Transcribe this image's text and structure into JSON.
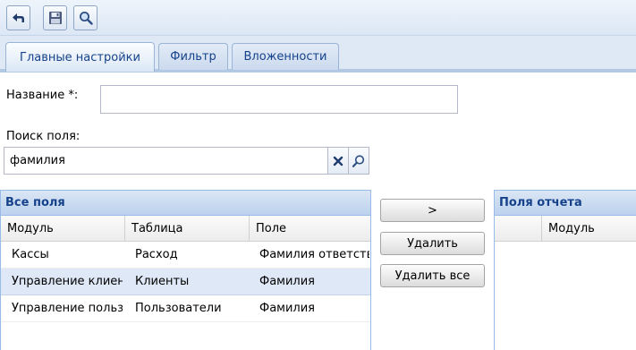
{
  "toolbar": {
    "back_icon": "back-arrow-icon",
    "save_icon": "floppy-disk-icon",
    "search_icon": "magnifier-icon"
  },
  "tabs": [
    {
      "label": "Главные настройки",
      "active": true
    },
    {
      "label": "Фильтр",
      "active": false
    },
    {
      "label": "Вложенности",
      "active": false
    }
  ],
  "form": {
    "name_label": "Название *:",
    "name_value": "",
    "search_label": "Поиск поля:",
    "search_value": "фамилия",
    "clear_icon": "close-x-icon",
    "search_icon": "magnifier-icon"
  },
  "all_fields": {
    "title": "Все поля",
    "columns": [
      "Модуль",
      "Таблица",
      "Поле"
    ],
    "rows": [
      {
        "module": "Кассы",
        "table": "Расход",
        "field": "Фамилия ответственного",
        "selected": false
      },
      {
        "module": "Управление клиентами",
        "table": "Клиенты",
        "field": "Фамилия",
        "selected": true
      },
      {
        "module": "Управление пользователями",
        "table": "Пользователи",
        "field": "Фамилия",
        "selected": false
      }
    ]
  },
  "buttons": {
    "add": ">",
    "remove": "Удалить",
    "remove_all": "Удалить все"
  },
  "report_fields": {
    "title": "Поля отчета",
    "columns": [
      "Модуль"
    ]
  },
  "colors": {
    "accent": "#15428b",
    "panel_border": "#99bbe8",
    "selected_row": "#dfe8f6"
  }
}
